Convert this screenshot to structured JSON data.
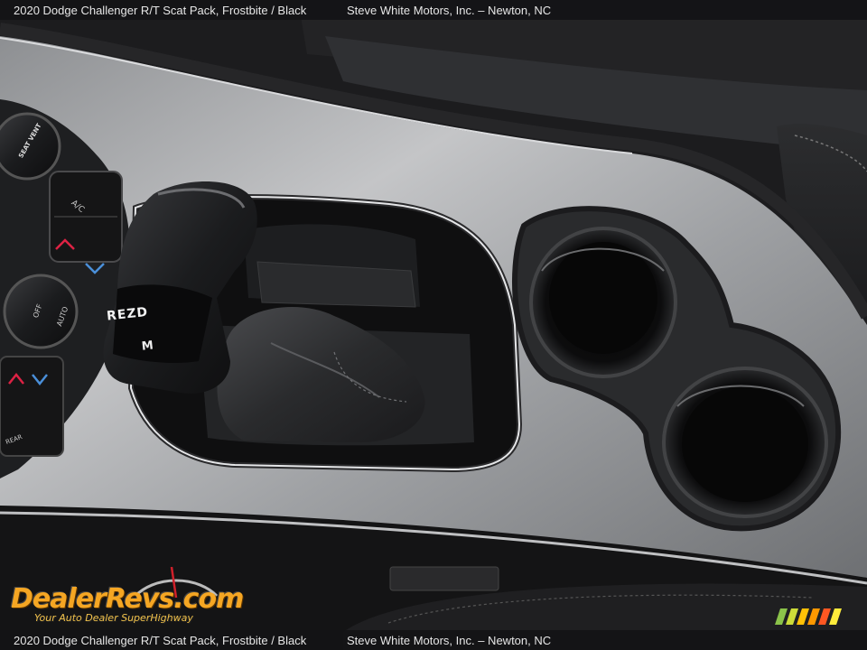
{
  "caption": {
    "vehicle": "2020 Dodge Challenger R/T Scat Pack,  Frostbite / Black",
    "dealer": "Steve White Motors, Inc.  – Newton, NC"
  },
  "watermark": {
    "logo": "DealerRevs.com",
    "tagline": "Your Auto Dealer SuperHighway"
  },
  "console": {
    "shifter_letters": "REZD",
    "shifter_letter_m": "M",
    "button_ac": "A/C",
    "button_auto": "AUTO",
    "button_off": "OFF",
    "button_rear": "REAR",
    "button_vent": "SEAT VENT"
  }
}
